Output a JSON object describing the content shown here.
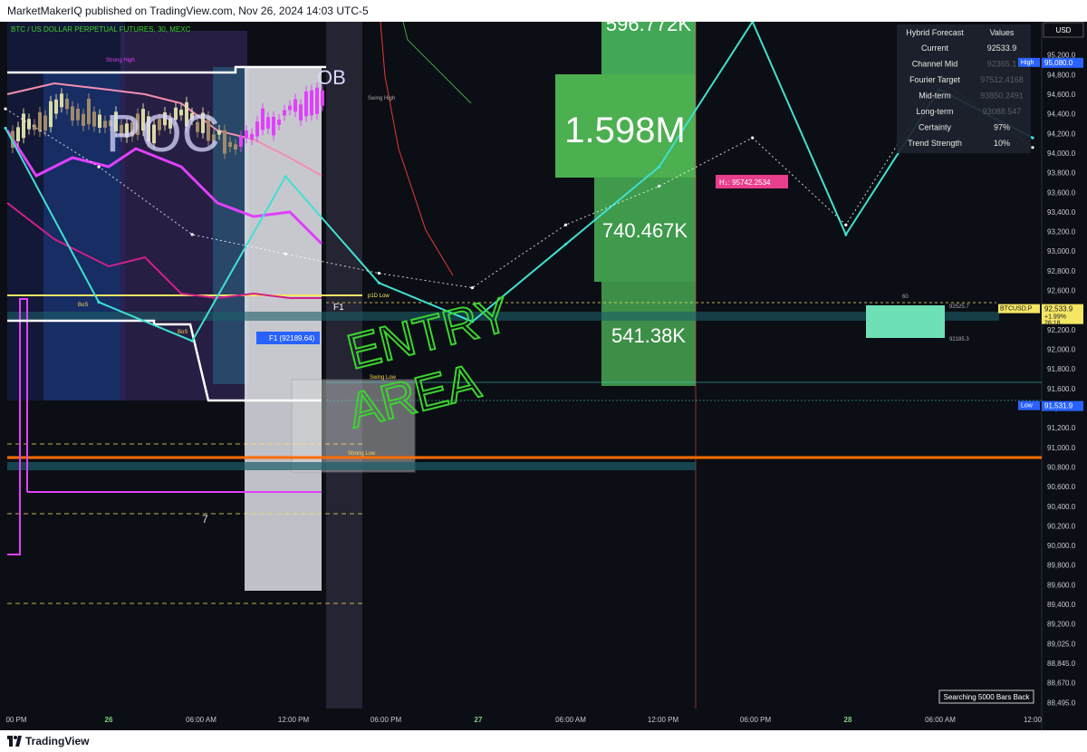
{
  "header": {
    "published": "MarketMakerIQ published on TradingView.com, Nov 26, 2024 14:03 UTC-5"
  },
  "footer": {
    "brand": "TradingView"
  },
  "symbol_line": "BTC / US DOLLAR PERPETUAL FUTURES, 30, MEXC",
  "currency": "USD",
  "colors": {
    "bg": "#0c0e15",
    "price_axis_text": "#c7c9d1",
    "cyan": "#40e0d0",
    "magenta": "#e040fb",
    "green_box": "#43a855",
    "orange": "#ff6d00",
    "yellow": "#f5e663",
    "handwriting": "#3bd42e",
    "tag_pink": "#e83e8c",
    "tag_blue": "#2962ff"
  },
  "forecast_table": {
    "headers": [
      "Hybrid Forecast",
      "Values"
    ],
    "rows": [
      [
        "Current",
        "92533.9"
      ],
      [
        "Channel Mid",
        "92365.1"
      ],
      [
        "Fourier Target",
        "97512.4168"
      ],
      [
        "Mid-term",
        "93850.2491"
      ],
      [
        "Long-term",
        "93088.547"
      ],
      [
        "Certainty",
        "97%"
      ],
      [
        "Trend Strength",
        "10%"
      ]
    ]
  },
  "volume_labels": [
    "596.772K",
    "1.598M",
    "740.467K",
    "541.38K"
  ],
  "labels": {
    "poc": "POC",
    "ob": "OB",
    "strong_high": "Strong High",
    "swing_high": "Swing High",
    "strong_low": "Strong Low",
    "swing_low": "Swing Low",
    "bos1": "BoS",
    "bos2": "BoS",
    "p1d_low": "p1D Low",
    "f1": "F1",
    "f1_tag": "F1 (92189.64)",
    "hl_tag": "H↓: 95742.2534",
    "seven": "7",
    "box_top": "92525.7",
    "box_bottom": "92185.3",
    "box_count": "60",
    "searching": "Searching 5000 Bars Back",
    "handwriting_1": "ENTRY",
    "handwriting_2": "AREA"
  },
  "price_axis": [
    "95,200.0",
    "94,800.0",
    "94,600.0",
    "94,400.0",
    "94,200.0",
    "94,000.0",
    "93,800.0",
    "93,600.0",
    "93,400.0",
    "93,200.0",
    "93,000.0",
    "92,800.0",
    "92,600.0",
    "92,400.0",
    "92,200.0",
    "92,000.0",
    "91,800.0",
    "91,600.0",
    "91,400.0",
    "91,200.0",
    "91,000.0",
    "90,800.0",
    "90,600.0",
    "90,400.0",
    "90,200.0",
    "90,000.0",
    "89,800.0",
    "89,600.0",
    "89,400.0",
    "89,200.0",
    "89,025.0",
    "88,845.0",
    "88,670.0",
    "88,495.0"
  ],
  "price_tags": [
    {
      "text": "95,080.0",
      "kind": "high",
      "label": "High"
    },
    {
      "text": "92,533.9",
      "kind": "last",
      "label": "BTCUSD.P",
      "change": "+1.99%",
      "countdown": "26:18"
    },
    {
      "text": "91,531.9",
      "kind": "low",
      "label": "Low"
    }
  ],
  "time_axis": [
    "00 PM",
    "26",
    "06:00 AM",
    "12:00 PM",
    "06:00 PM",
    "27",
    "06:00 AM",
    "12:00 PM",
    "06:00 PM",
    "28",
    "06:00 AM",
    "12:00"
  ],
  "chart_data": {
    "type": "line",
    "title": "BTC / US DOLLAR PERPETUAL FUTURES, 30, MEXC",
    "xlabel": "",
    "ylabel": "",
    "ylim": [
      88400,
      95500
    ],
    "x": [
      "25 18:00",
      "26 00:00",
      "26 06:00",
      "26 12:00",
      "26 18:00",
      "27 00:00",
      "27 06:00",
      "27 12:00",
      "27 18:00",
      "28 00:00",
      "28 06:00",
      "28 12:00"
    ],
    "series": [
      {
        "values": [
          94400,
          92600,
          92200,
          93900,
          92800,
          92400,
          93200,
          94000,
          95500,
          93300,
          94800,
          94300
        ]
      },
      {
        "values": [
          94600,
          94000,
          93300,
          93100,
          92900,
          92750,
          93400,
          93800,
          94300,
          93400,
          94900,
          94200
        ]
      }
    ],
    "levels": {
      "high": 95080.0,
      "last": 92533.9,
      "low": 91531.9,
      "f1": 92189.64,
      "forecast_high": 95742.2534,
      "orange_line": 90950
    },
    "grid": false,
    "legend": "top-right"
  }
}
